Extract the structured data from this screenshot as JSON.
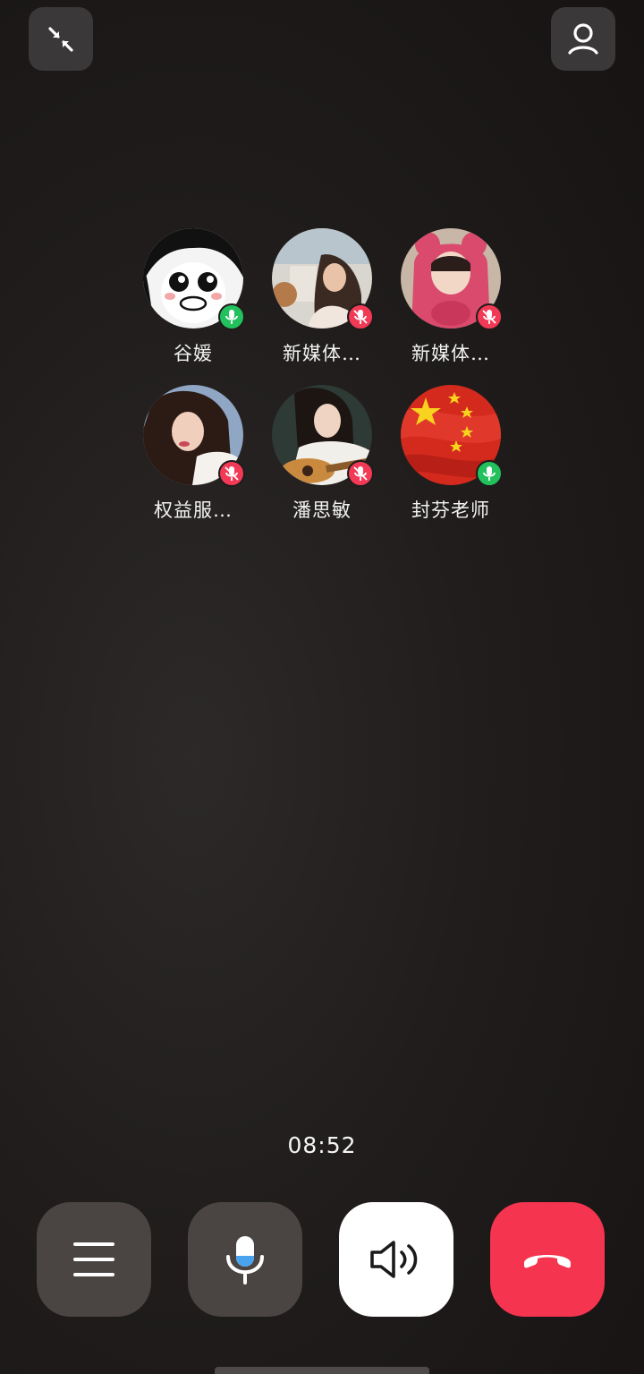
{
  "top_bar": {
    "minimize_icon": "collapse-arrows-icon",
    "add_member_icon": "person-icon"
  },
  "participants": [
    {
      "name": "谷媛",
      "mic": "on"
    },
    {
      "name": "新媒体…",
      "mic": "off"
    },
    {
      "name": "新媒体…",
      "mic": "off"
    },
    {
      "name": "权益服…",
      "mic": "off"
    },
    {
      "name": "潘思敏",
      "mic": "off"
    },
    {
      "name": "封芬老师",
      "mic": "on"
    }
  ],
  "call": {
    "timer": "08:52"
  },
  "controls": {
    "menu_icon": "menu-icon",
    "mic_icon": "microphone-icon",
    "speaker_icon": "speaker-icon",
    "hangup_icon": "hang-up-icon"
  },
  "colors": {
    "mic_on": "#22c15e",
    "mic_off": "#f23a57",
    "hangup": "#f5344f",
    "speaker_active": "#ffffff"
  }
}
